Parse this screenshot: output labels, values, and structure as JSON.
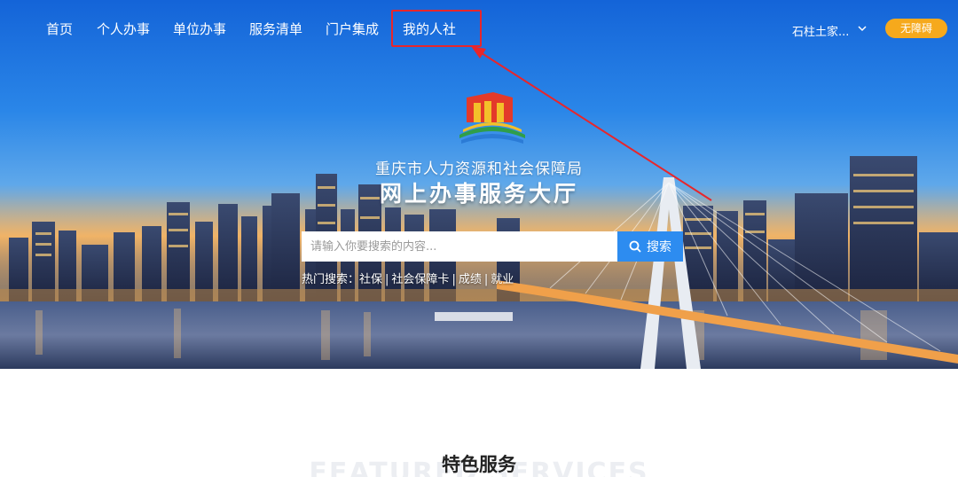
{
  "nav": {
    "items": [
      {
        "label": "首页"
      },
      {
        "label": "个人办事"
      },
      {
        "label": "单位办事"
      },
      {
        "label": "服务清单"
      },
      {
        "label": "门户集成"
      },
      {
        "label": "我的人社"
      }
    ],
    "user_name": "石柱土家...",
    "accessibility_label": "无障碍"
  },
  "hero": {
    "org_name": "重庆市人力资源和社会保障局",
    "hall_title": "网上办事服务大厅"
  },
  "search": {
    "placeholder": "请输入你要搜索的内容...",
    "button_label": "搜索"
  },
  "hot_search": {
    "label": "热门搜索：",
    "items": [
      "社保",
      "社会保障卡",
      "成绩",
      "就业"
    ]
  },
  "features": {
    "title_cn": "特色服务",
    "title_en": "FEATURED SERVICES"
  },
  "colors": {
    "highlight_red": "#e8262b",
    "accent_blue": "#2d8cf0",
    "access_orange": "#f6a91c"
  }
}
